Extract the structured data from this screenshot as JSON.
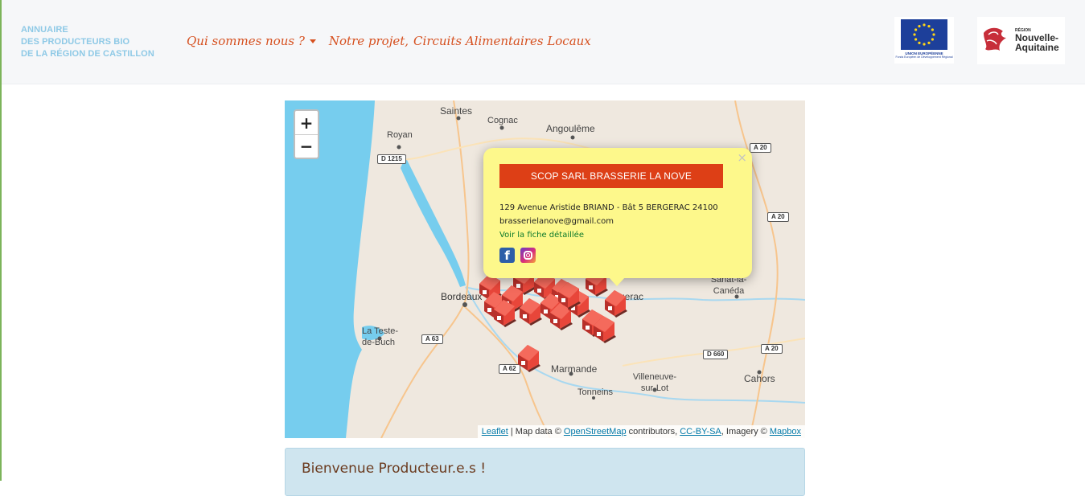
{
  "brand": {
    "line1": "ANNUAIRE",
    "line2": "DES PRODUCTEURS BIO",
    "line3": "DE LA RÉGION DE CASTILLON"
  },
  "nav": {
    "items": [
      {
        "label": "Qui sommes nous ?",
        "has_dropdown": true
      },
      {
        "label": "Notre projet,"
      },
      {
        "label": "Circuits Alimentaires Locaux"
      }
    ]
  },
  "logos": {
    "eu": {
      "caption1": "UNION EUROPÉENNE",
      "caption2": "Fonds Européen de Développement Régional"
    },
    "region": {
      "small": "RÉGION",
      "line1": "Nouvelle-",
      "line2": "Aquitaine"
    }
  },
  "map": {
    "zoom_in": "+",
    "zoom_out": "−",
    "places": [
      "Saintes",
      "Cognac",
      "Angoulême",
      "Royan",
      "Bordeaux",
      "La Teste-de-Buch",
      "Marmande",
      "Tonneins",
      "Villeneuve-sur-Lot",
      "Cahors",
      "Sarlat-la-Canéda",
      "Bergerac"
    ],
    "road_labels": [
      "D 1215",
      "A 20",
      "A 20",
      "A 63",
      "A 62",
      "D 660",
      "A 20"
    ],
    "attribution": {
      "leaflet": "Leaflet",
      "map_data": "| Map data ©",
      "osm": "OpenStreetMap",
      "contributors": "contributors,",
      "license": "CC-BY-SA",
      "imagery": ", Imagery ©",
      "mapbox": "Mapbox"
    },
    "marker_color": "#e8463a"
  },
  "popup": {
    "title": "SCOP SARL BRASSERIE LA NOVE",
    "address": "129 Avenue Aristide BRIAND - Bât 5 BERGERAC 24100",
    "email": "brasserielanove@gmail.com",
    "link": "Voir la fiche détaillée",
    "close": "×",
    "facebook": "f"
  },
  "welcome": {
    "title": "Bienvenue Producteur.e.s !"
  },
  "colors": {
    "accent": "#d6501f",
    "popup_bg": "#fdf88b",
    "popup_title_bg": "#dd3f16",
    "water": "#76cdee"
  }
}
